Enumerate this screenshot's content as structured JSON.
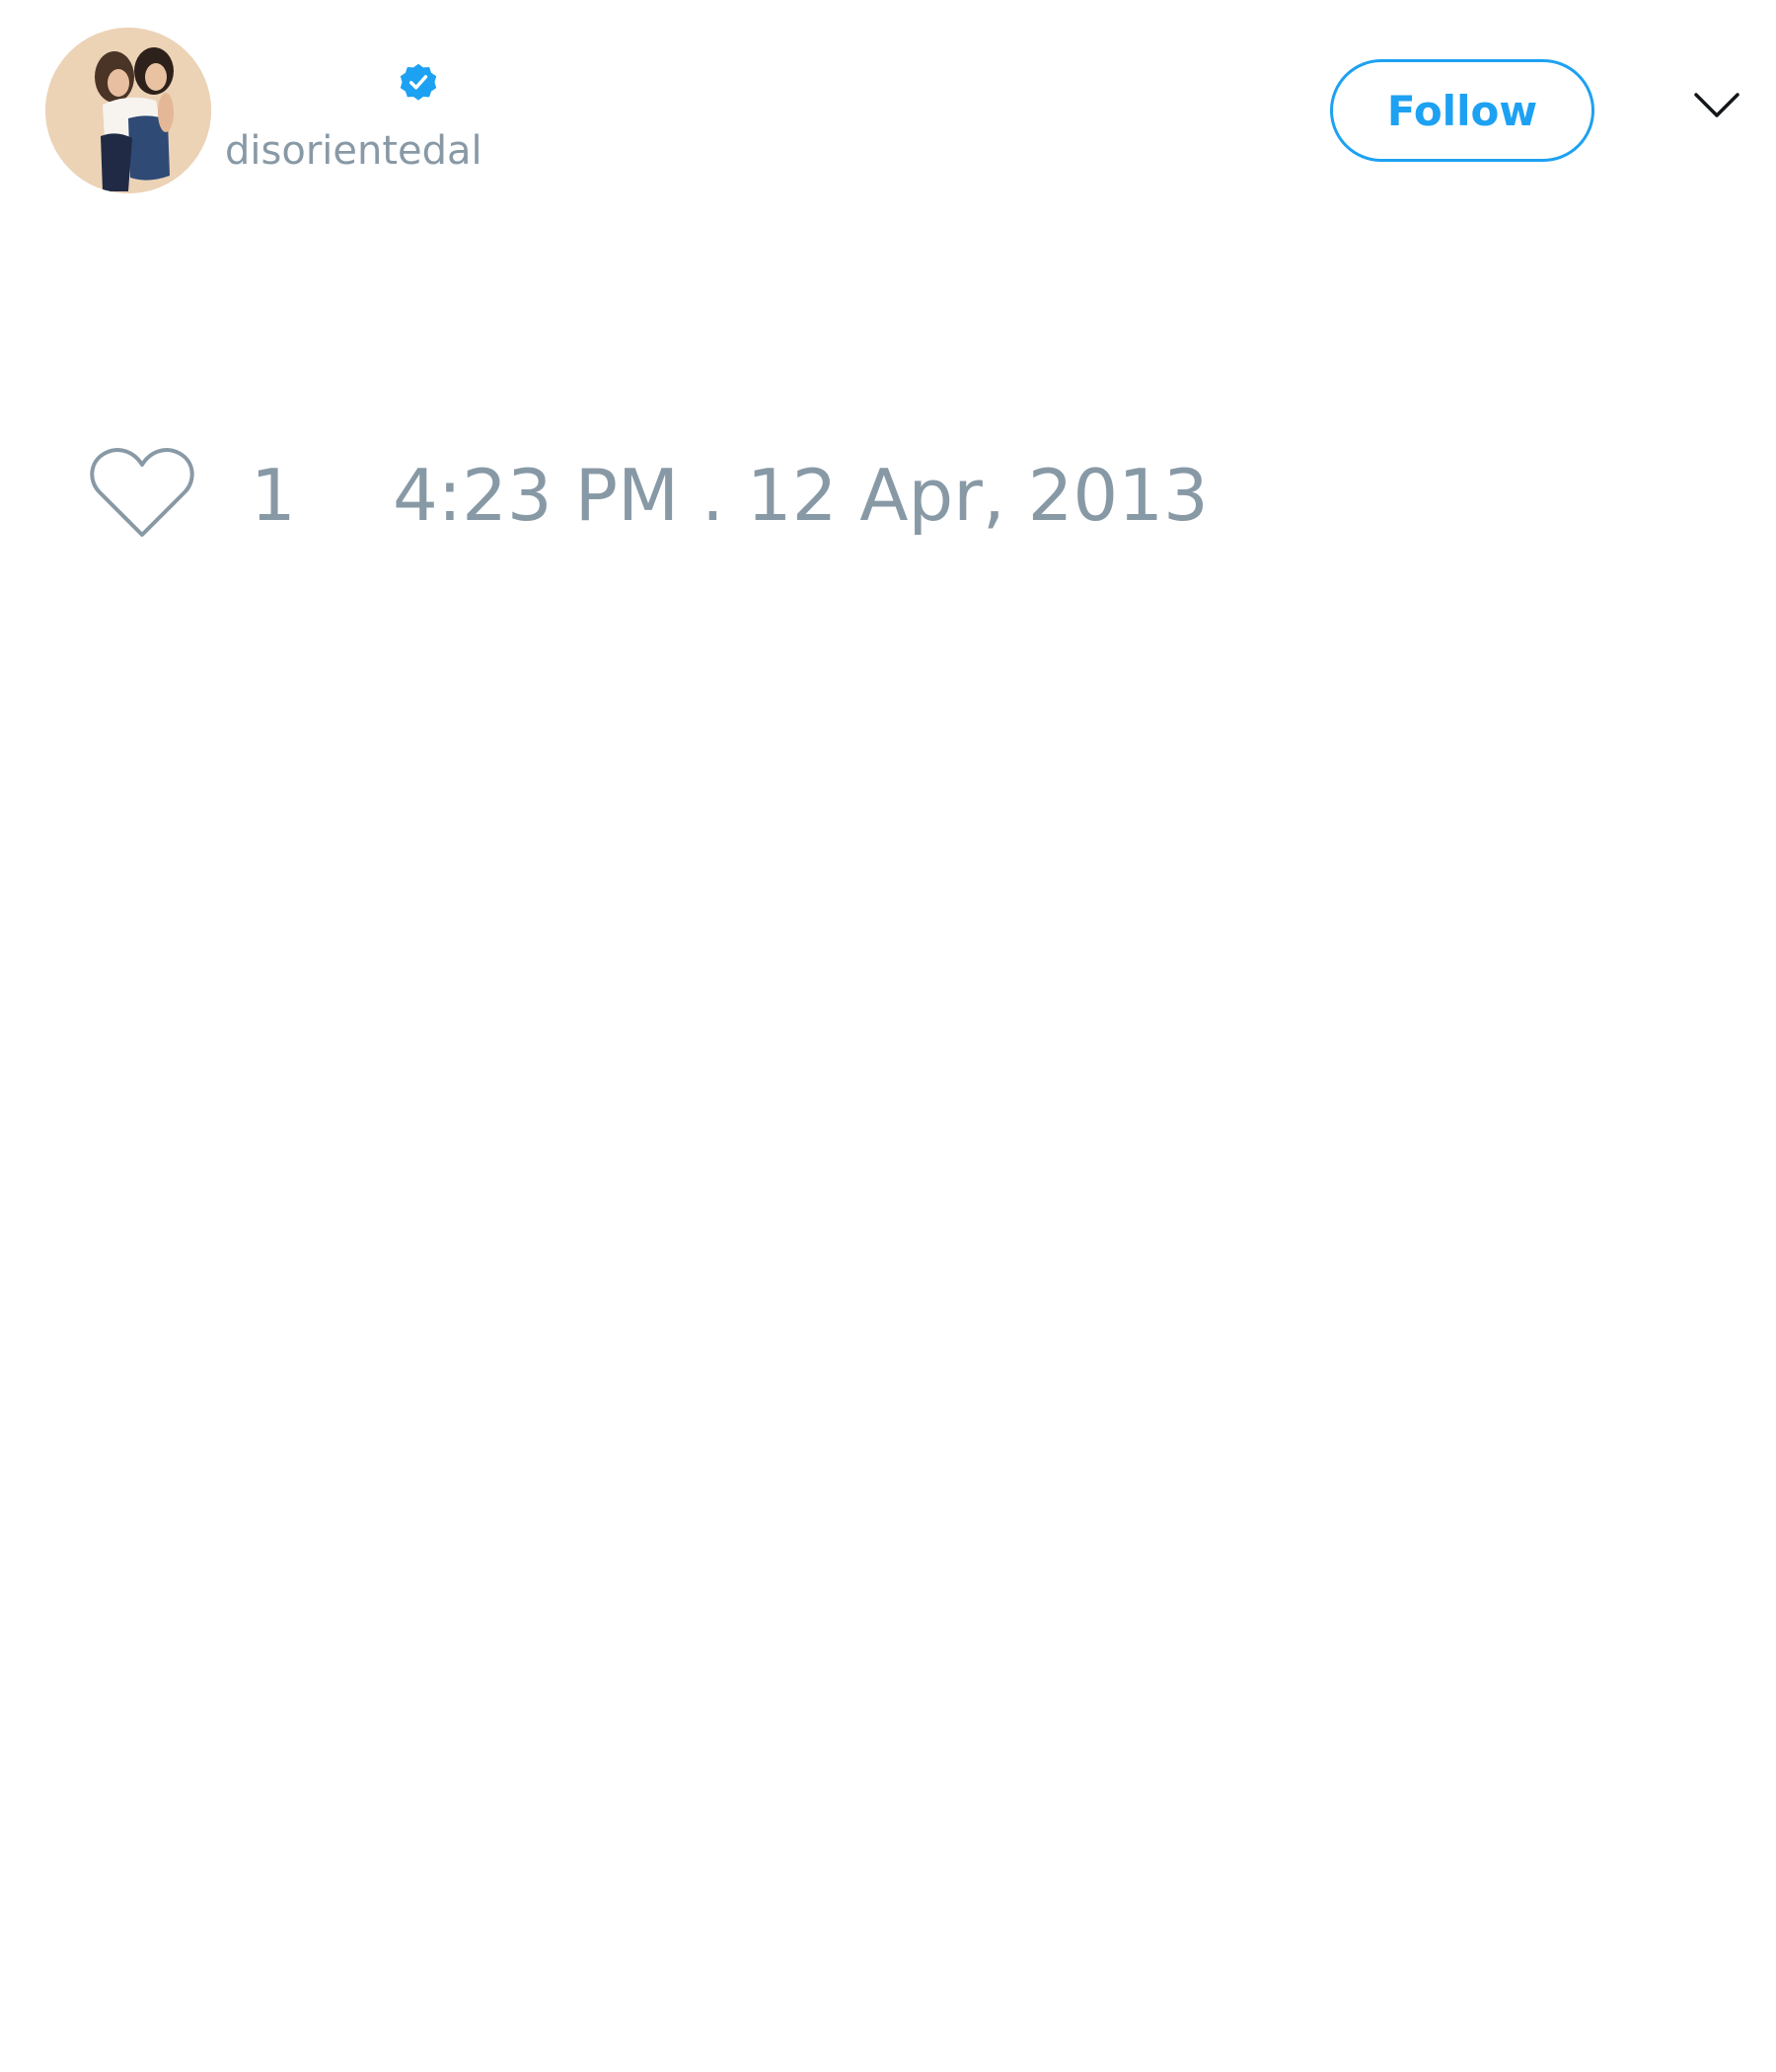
{
  "tweet": {
    "author": {
      "handle": "disorientedal",
      "verified": true,
      "avatar_icon": "profile-photo"
    },
    "follow_label": "Follow",
    "menu_icon": "chevron-down-icon",
    "like_icon": "heart-icon",
    "like_count": "1",
    "timestamp": "4:23 PM . 12 Apr, 2013"
  },
  "colors": {
    "accent": "#1da1f2",
    "muted_text": "#8899a6"
  }
}
